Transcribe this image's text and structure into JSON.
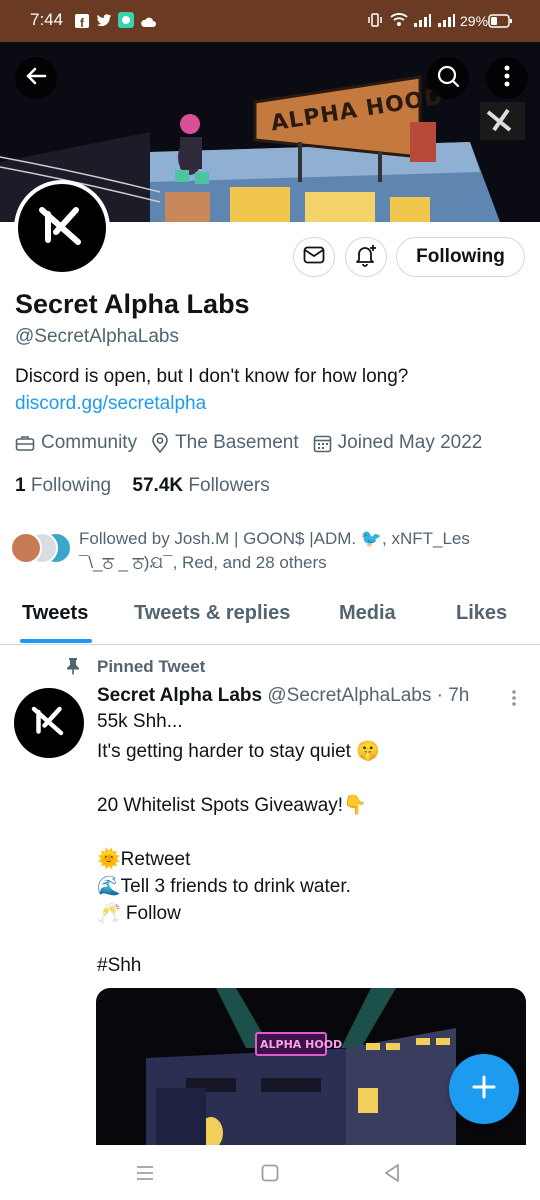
{
  "status_bar": {
    "time": "7:44",
    "battery": "29%",
    "app_icons": [
      "facebook-icon",
      "twitter-icon",
      "messaging-icon",
      "cloud-icon"
    ],
    "system_icons": [
      "vibrate-icon",
      "wifi-icon",
      "signal-icon",
      "signal-icon",
      "battery-icon"
    ]
  },
  "banner": {
    "sign_text": "ALPHA HOOD"
  },
  "profile": {
    "display_name": "Secret Alpha Labs",
    "handle": "@SecretAlphaLabs",
    "bio": "Discord is open, but I don't know for how long?",
    "link": "discord.gg/secretalpha",
    "category": "Community",
    "location": "The Basement",
    "joined": "Joined May 2022",
    "following_count": "1",
    "following_label": "Following",
    "followers_count": "57.4K",
    "followers_label": "Followers",
    "follow_button": "Following",
    "followed_by_line1": "Followed by Josh.M | GOON$ |ADM. 🐦, xNFT_Les",
    "followed_by_line2": "¯\\_ਠ _ ਠ)ଯ¯, Red, and 28 others"
  },
  "tabs": [
    "Tweets",
    "Tweets & replies",
    "Media",
    "Likes"
  ],
  "active_tab": "Tweets",
  "pinned_tweet": {
    "pinned_label": "Pinned Tweet",
    "author": "Secret Alpha Labs",
    "handle_time": "@SecretAlphaLabs · 7h",
    "lines": [
      "55k Shh...",
      "It's getting harder to stay quiet 🤫",
      "",
      "20 Whitelist Spots Giveaway!👇",
      "",
      "🌞Retweet",
      "🌊Tell 3 friends to drink water.",
      "🥂 Follow",
      "",
      "#Shh"
    ],
    "image_sign": "ALPHA HOOD"
  },
  "colors": {
    "accent": "#1d9bf0",
    "status_bar": "#6b3a22",
    "text_secondary": "#536471"
  }
}
